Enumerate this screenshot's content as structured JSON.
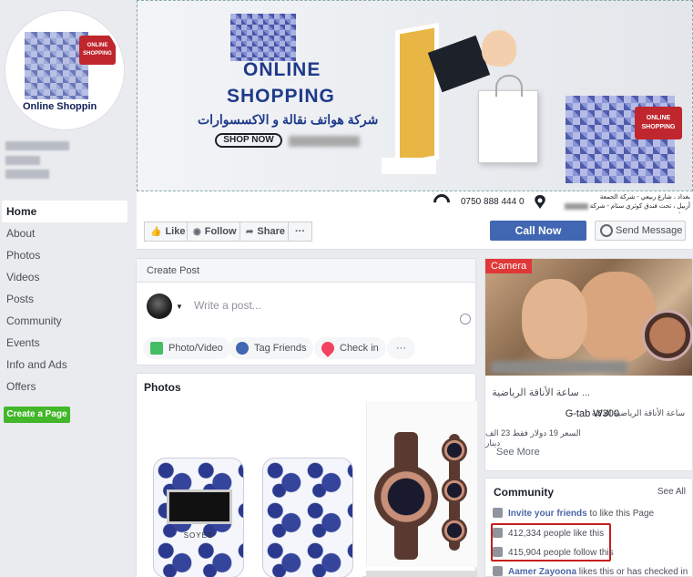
{
  "page": {
    "profile_band_text": "Online Shoppin",
    "profile_bag_text": "ONLINE SHOPPING"
  },
  "nav": {
    "items": [
      {
        "label": "Home",
        "active": true
      },
      {
        "label": "About"
      },
      {
        "label": "Photos"
      },
      {
        "label": "Videos"
      },
      {
        "label": "Posts"
      },
      {
        "label": "Community"
      },
      {
        "label": "Events"
      },
      {
        "label": "Info and Ads"
      },
      {
        "label": "Offers"
      }
    ],
    "create_page": "Create a Page"
  },
  "cover": {
    "title_line1": "ONLINE",
    "title_line2": "SHOPPING",
    "arabic_subtitle": "شركة هواتف نقالة و الاكسسوارات",
    "shop_now": "SHOP NOW",
    "bag_text": "ONLINE SHOPPING",
    "phone": "0750 888 444 0",
    "address_line1": "بغداد ، شارع ربيعي - شركة الجمعة",
    "address_line2": "أربيل ، تحت فندق كوثري ستام - شركة زيونا"
  },
  "actions": {
    "like": "Like",
    "follow": "Follow",
    "share": "Share",
    "more": "···",
    "call_now": "Call Now",
    "send_message": "Send Message"
  },
  "create_post": {
    "header": "Create Post",
    "placeholder": "Write a post...",
    "photo_video": "Photo/Video",
    "tag_friends": "Tag Friends",
    "check_in": "Check in",
    "more": "···"
  },
  "photos": {
    "title": "Photos",
    "phone_brand": "SOYES"
  },
  "ad": {
    "tag": "Camera",
    "line1": "ساعة الأناقة الرياضية ...",
    "line2_arabic": "ساعة الأناقة الرياضية الذكية",
    "line2_model": "G-tab W300",
    "line3": "السعر 19 دولار فقط 23 الف دينار",
    "see_more": "See More"
  },
  "community": {
    "title": "Community",
    "see_all": "See All",
    "invite_link": "Invite your friends",
    "invite_rest": " to like this Page",
    "likes": "412,334 people like this",
    "follows": "415,904 people follow this",
    "checkin_name": "Aamer Zayoona",
    "checkin_rest": " likes this or has checked in"
  },
  "colors": {
    "primary": "#4267b2",
    "green": "#42b72a",
    "highlight": "#c81e1e",
    "camera_tag": "#e03838"
  }
}
